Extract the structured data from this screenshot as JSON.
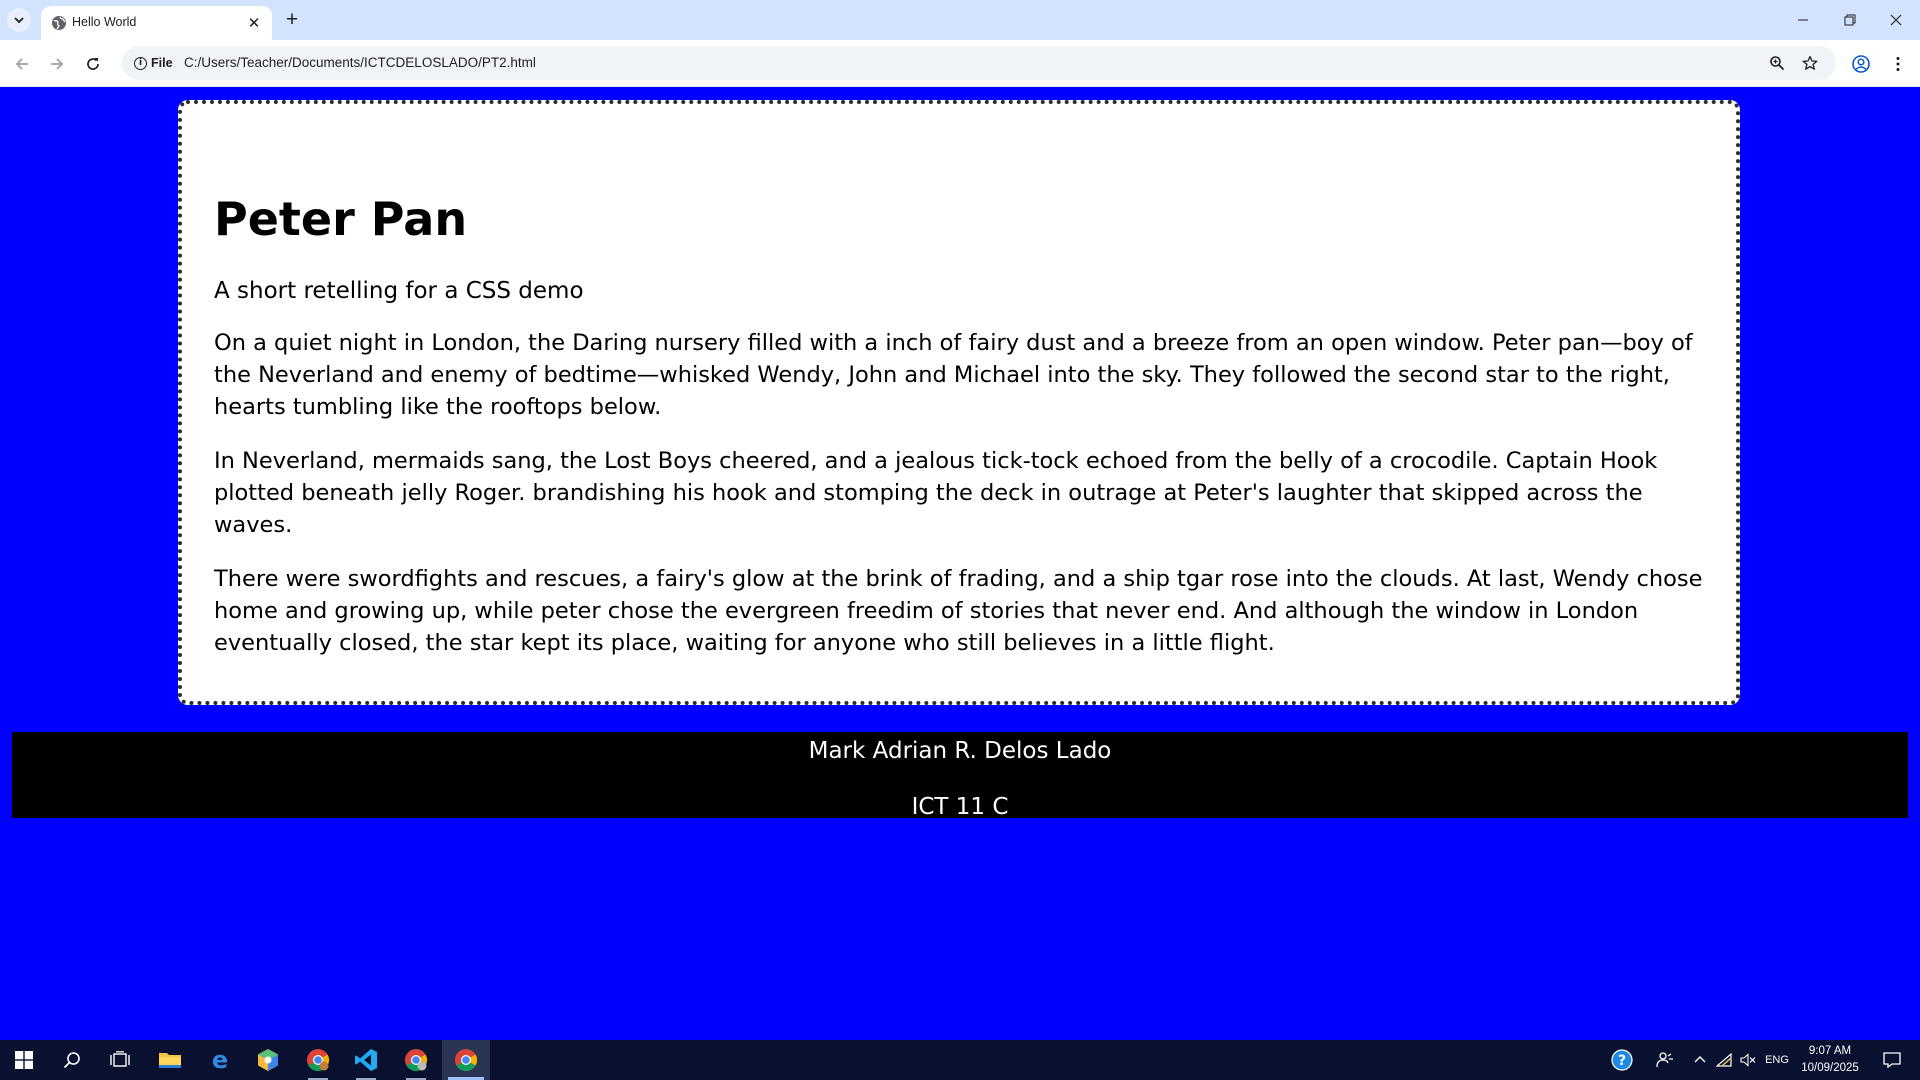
{
  "browser": {
    "tab_title": "Hello World",
    "site_chip_label": "File",
    "url": "C:/Users/Teacher/Documents/ICTCDELOSLADO/PT2.html"
  },
  "page": {
    "background_color": "#0000ff",
    "title": "Peter Pan",
    "subtitle": "A short retelling for a CSS demo",
    "paragraphs": [
      "On a quiet night in London, the Daring nursery filled with a inch of fairy dust and a breeze from an open window. Peter pan—boy of the Neverland and enemy of bedtime—whisked Wendy, John and Michael into the sky. They followed the second star to the right, hearts tumbling like the rooftops below.",
      "In Neverland, mermaids sang, the Lost Boys cheered, and a jealous tick-tock echoed from the belly of a crocodile. Captain Hook plotted beneath jelly Roger. brandishing his hook and stomping the deck in outrage at Peter's laughter that skipped across the waves.",
      "There were swordfights and rescues, a fairy's glow at the brink of frading, and a ship tgar rose into the clouds. At last, Wendy chose home and growing up, while peter chose the evergreen freedim of stories that never end. And although the window in London eventually closed, the star kept its place, waiting for anyone who still believes in a little flight."
    ],
    "footer_name": "Mark Adrian R. Delos Lado",
    "footer_section": "ICT 11 C"
  },
  "taskbar": {
    "icons": [
      "windows-start-icon",
      "search-icon",
      "task-view-icon",
      "file-explorer-icon",
      "edge-legacy-icon",
      "app-cube-icon",
      "chrome-profile-icon",
      "vscode-icon",
      "chrome-profile-2-icon",
      "chrome-icon"
    ],
    "tray_language": "ENG",
    "time": "9:07 AM",
    "date": "10/09/2025"
  }
}
